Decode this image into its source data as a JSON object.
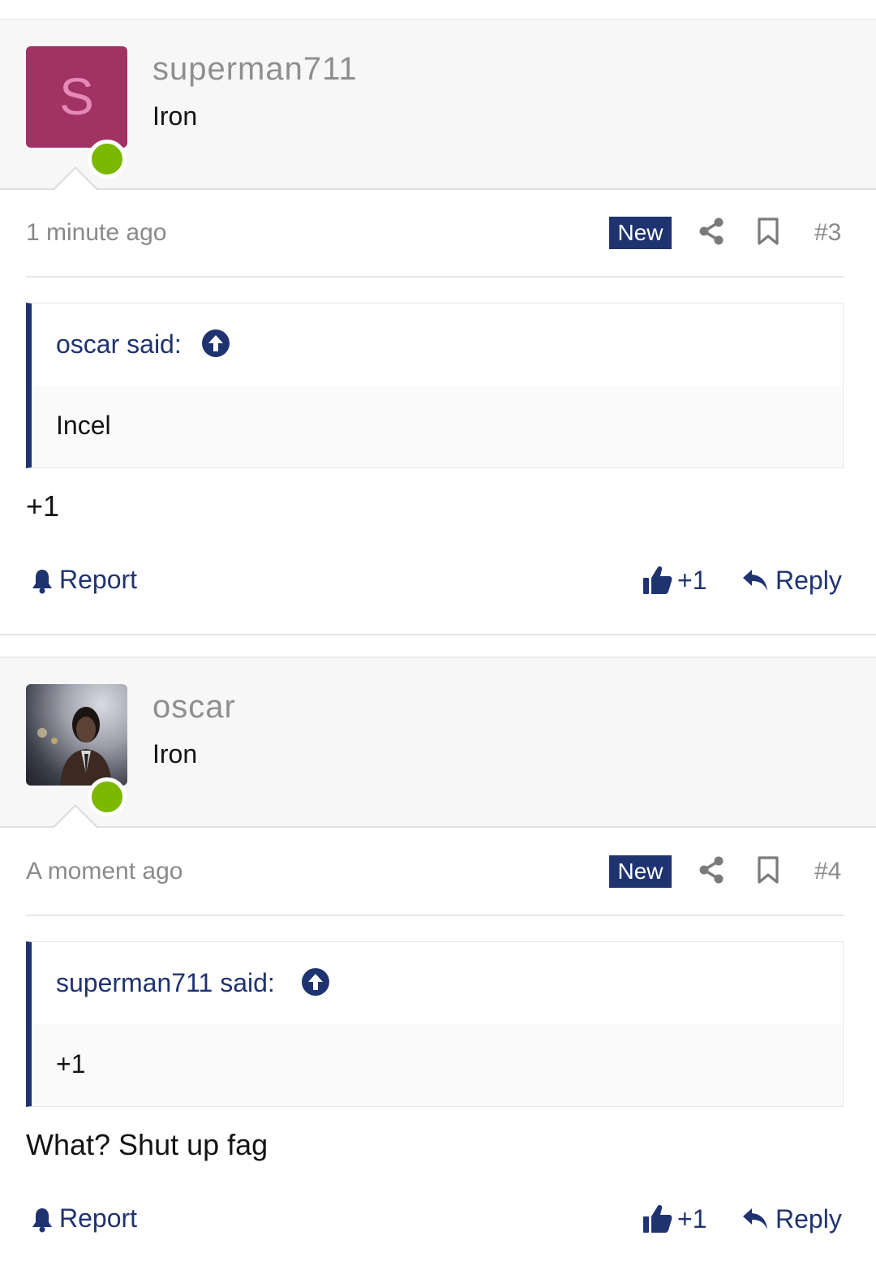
{
  "posts": [
    {
      "username": "superman711",
      "user_title": "Iron",
      "avatar_letter": "S",
      "time": "1 minute ago",
      "badge": "New",
      "post_number": "#3",
      "quote_author": "oscar said:",
      "quote_body": "Incel",
      "message": "+1",
      "report_label": "Report",
      "like_label": "+1",
      "reply_label": "Reply"
    },
    {
      "username": "oscar",
      "user_title": "Iron",
      "time": "A moment ago",
      "badge": "New",
      "post_number": "#4",
      "quote_author": "superman711 said:",
      "quote_body": "+1",
      "message": "What? Shut up fag",
      "report_label": "Report",
      "like_label": "+1",
      "reply_label": "Reply"
    }
  ],
  "colors": {
    "accent": "#1f3370",
    "online": "#7cb800",
    "avatar_bg": "#a13264",
    "avatar_letter": "#e589b6"
  }
}
